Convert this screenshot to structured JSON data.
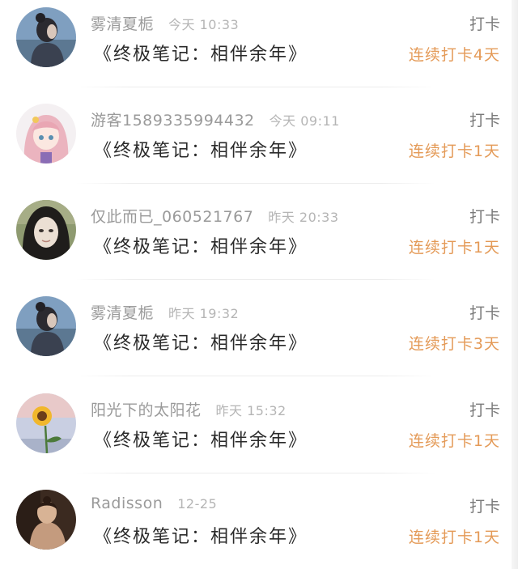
{
  "checkins": [
    {
      "username": "雾清夏栀",
      "time": "今天 10:33",
      "title": "《终极笔记：相伴余年》",
      "action": "打卡",
      "streak": "连续打卡4天",
      "avatar": "dark-haired-woman-avatar"
    },
    {
      "username": "游客1589335994432",
      "time": "今天 09:11",
      "title": "《终极笔记：相伴余年》",
      "action": "打卡",
      "streak": "连续打卡1天",
      "avatar": "pink-anime-girl-avatar"
    },
    {
      "username": "仅此而已_060521767",
      "time": "昨天 20:33",
      "title": "《终极笔记：相伴余年》",
      "action": "打卡",
      "streak": "连续打卡1天",
      "avatar": "woman-portrait-avatar"
    },
    {
      "username": "雾清夏栀",
      "time": "昨天 19:32",
      "title": "《终极笔记：相伴余年》",
      "action": "打卡",
      "streak": "连续打卡3天",
      "avatar": "dark-haired-woman-avatar"
    },
    {
      "username": "阳光下的太阳花",
      "time": "昨天 15:32",
      "title": "《终极笔记：相伴余年》",
      "action": "打卡",
      "streak": "连续打卡1天",
      "avatar": "sunflower-avatar"
    },
    {
      "username": "Radisson",
      "time": "12-25",
      "title": "《终极笔记：相伴余年》",
      "action": "打卡",
      "streak": "连续打卡1天",
      "avatar": "vintage-woman-avatar"
    }
  ],
  "colors": {
    "streak": "#e49a57",
    "username": "#9a9a9a",
    "time": "#b5b5b5",
    "title": "#2a2a2a",
    "action": "#7a7a7a"
  }
}
